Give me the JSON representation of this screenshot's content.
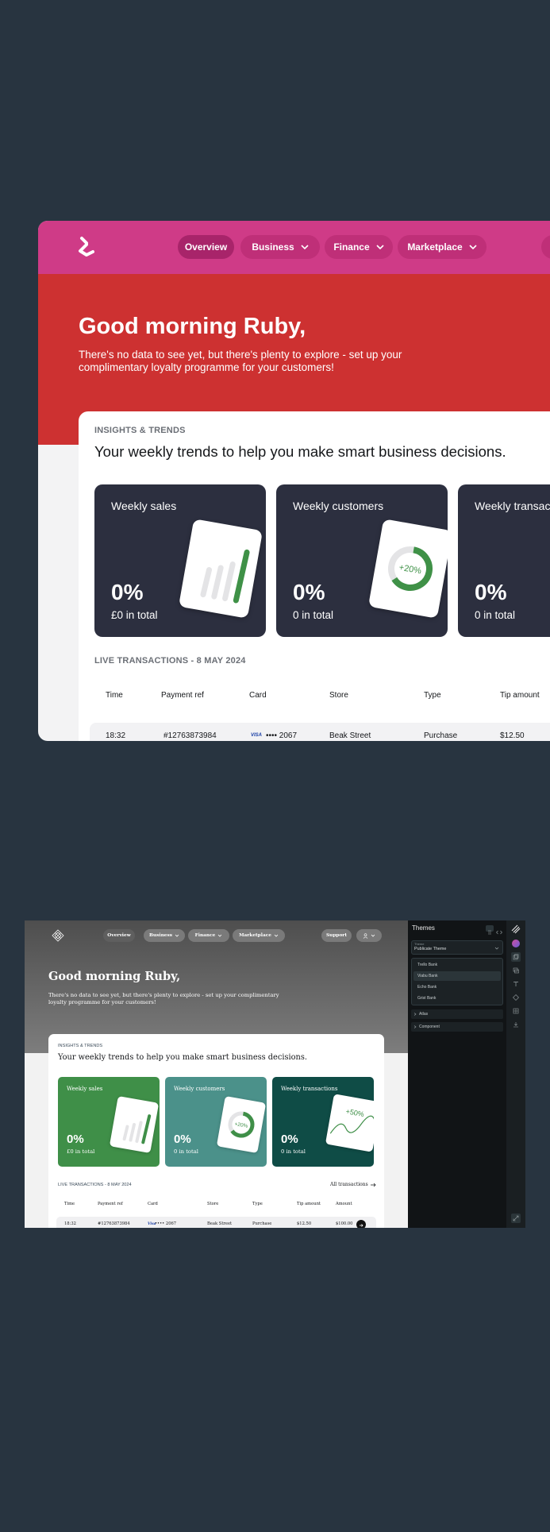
{
  "top": {
    "nav": {
      "overview": "Overview",
      "business": "Business",
      "finance": "Finance",
      "marketplace": "Marketplace"
    },
    "greeting": "Good morning Ruby,",
    "intro": "There's no data to see yet, but there's plenty to explore - set up your complimentary loyalty programme for your customers!",
    "insights_label": "INSIGHTS & TRENDS",
    "subheading": "Your weekly trends to help you make smart business decisions.",
    "cards": [
      {
        "title": "Weekly sales",
        "value": "0%",
        "total": "£0 in total"
      },
      {
        "title": "Weekly customers",
        "value": "0%",
        "total": "0 in total",
        "badge": "+20%"
      },
      {
        "title": "Weekly transactions",
        "value": "0%",
        "total": "0 in total"
      }
    ],
    "live_label": "LIVE TRANSACTIONS - 8 MAY 2024",
    "columns": [
      "Time",
      "Payment ref",
      "Card",
      "Store",
      "Type",
      "Tip amount"
    ],
    "row": {
      "time": "18:32",
      "ref": "#12763873984",
      "card_brand": "VISA",
      "card_last4": "•••• 2067",
      "store": "Beak Street",
      "type": "Purchase",
      "tip": "$12.50"
    },
    "colors": {
      "nav": "#cf3b87",
      "hero": "#cd3131",
      "card": "#2c2f3f",
      "accent": "#3f9147"
    }
  },
  "bottom": {
    "nav": {
      "overview": "Overview",
      "business": "Business",
      "finance": "Finance",
      "marketplace": "Marketplace",
      "support": "Support"
    },
    "greeting": "Good morning Ruby,",
    "intro": "There's no data to see yet, but there's plenty to explore - set up your complimentary loyalty programme for your customers!",
    "insights_label": "INSIGHTS & TRENDS",
    "subheading": "Your weekly trends to help you make smart business decisions.",
    "cards": [
      {
        "title": "Weekly sales",
        "value": "0%",
        "total": "£0 in total",
        "color": "#3f8f48"
      },
      {
        "title": "Weekly customers",
        "value": "0%",
        "total": "0 in total",
        "badge": "+20%",
        "color": "#4b918a"
      },
      {
        "title": "Weekly transactions",
        "value": "0%",
        "total": "0 in total",
        "badge": "+50%",
        "color": "#0f4c46"
      }
    ],
    "live_label": "LIVE TRANSACTIONS - 8 MAY 2024",
    "all_transactions": "All transactions",
    "columns": [
      "Time",
      "Payment ref",
      "Card",
      "Store",
      "Type",
      "Tip amount",
      "Amount"
    ],
    "row": {
      "time": "18:32",
      "ref": "#12763873984",
      "card_brand": "Visa",
      "card_last4": "•••• 2067",
      "store": "Beak Street",
      "type": "Purchase",
      "tip": "$12.50",
      "amount": "$100.00"
    }
  },
  "themes": {
    "title": "Themes",
    "select_label": "Theme",
    "select_value": "Publicate Theme",
    "options": [
      "Trello Bank",
      "Viabu Bank",
      "Echo Bank",
      "Grist Bank"
    ],
    "selected_option": "Viabu Bank",
    "sections": [
      "Atlas",
      "Component"
    ]
  }
}
